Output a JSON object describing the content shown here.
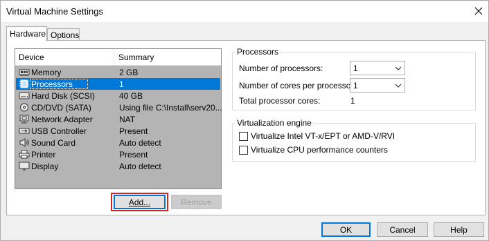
{
  "window": {
    "title": "Virtual Machine Settings",
    "close_icon": "close-icon"
  },
  "tabs": [
    {
      "label": "Hardware",
      "active": true
    },
    {
      "label": "Options",
      "active": false
    }
  ],
  "device_list": {
    "headers": {
      "device": "Device",
      "summary": "Summary"
    },
    "rows": [
      {
        "name": "Memory",
        "summary": "2 GB",
        "icon": "memory-icon",
        "selected": false
      },
      {
        "name": "Processors",
        "summary": "1",
        "icon": "processor-icon",
        "selected": true
      },
      {
        "name": "Hard Disk (SCSI)",
        "summary": "40 GB",
        "icon": "hard-disk-icon",
        "selected": false
      },
      {
        "name": "CD/DVD (SATA)",
        "summary": "Using file C:\\Install\\serv20...",
        "icon": "cd-dvd-icon",
        "selected": false
      },
      {
        "name": "Network Adapter",
        "summary": "NAT",
        "icon": "network-adapter-icon",
        "selected": false
      },
      {
        "name": "USB Controller",
        "summary": "Present",
        "icon": "usb-icon",
        "selected": false
      },
      {
        "name": "Sound Card",
        "summary": "Auto detect",
        "icon": "speaker-icon",
        "selected": false
      },
      {
        "name": "Printer",
        "summary": "Present",
        "icon": "printer-icon",
        "selected": false
      },
      {
        "name": "Display",
        "summary": "Auto detect",
        "icon": "display-icon",
        "selected": false
      }
    ]
  },
  "buttons": {
    "add": "Add...",
    "remove": "Remove",
    "ok": "OK",
    "cancel": "Cancel",
    "help": "Help"
  },
  "processors": {
    "group_title": "Processors",
    "num_processors_label": "Number of processors:",
    "num_processors_value": "1",
    "cores_label": "Number of cores per processor:",
    "cores_value": "1",
    "total_label": "Total processor cores:",
    "total_value": "1"
  },
  "virtualization": {
    "group_title": "Virtualization engine",
    "vtx_label": "Virtualize Intel VT-x/EPT or AMD-V/RVI",
    "vtx_checked": false,
    "perf_label": "Virtualize CPU performance counters",
    "perf_checked": false
  },
  "colors": {
    "selection": "#0078d7",
    "highlight_box": "#d9231d"
  }
}
